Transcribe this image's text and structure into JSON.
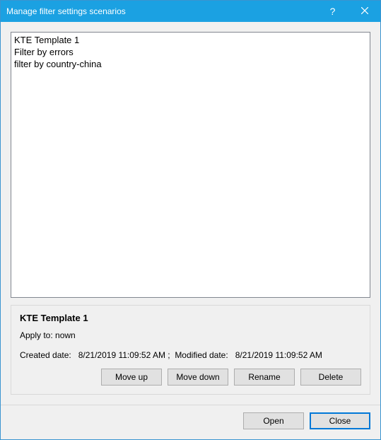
{
  "titlebar": {
    "title": "Manage filter settings scenarios"
  },
  "scenarios": {
    "items": [
      {
        "name": "KTE Template 1"
      },
      {
        "name": "Filter by errors"
      },
      {
        "name": "filter by country-china"
      }
    ]
  },
  "details": {
    "selected_name": "KTE Template 1",
    "apply_to_label": "Apply to:",
    "apply_to_value": "nown",
    "created_label": "Created date:",
    "created_value": "8/21/2019 11:09:52 AM",
    "modified_label": "Modified date:",
    "modified_value": "8/21/2019 11:09:52 AM"
  },
  "buttons": {
    "move_up": "Move up",
    "move_down": "Move down",
    "rename": "Rename",
    "delete": "Delete",
    "open": "Open",
    "close": "Close"
  }
}
